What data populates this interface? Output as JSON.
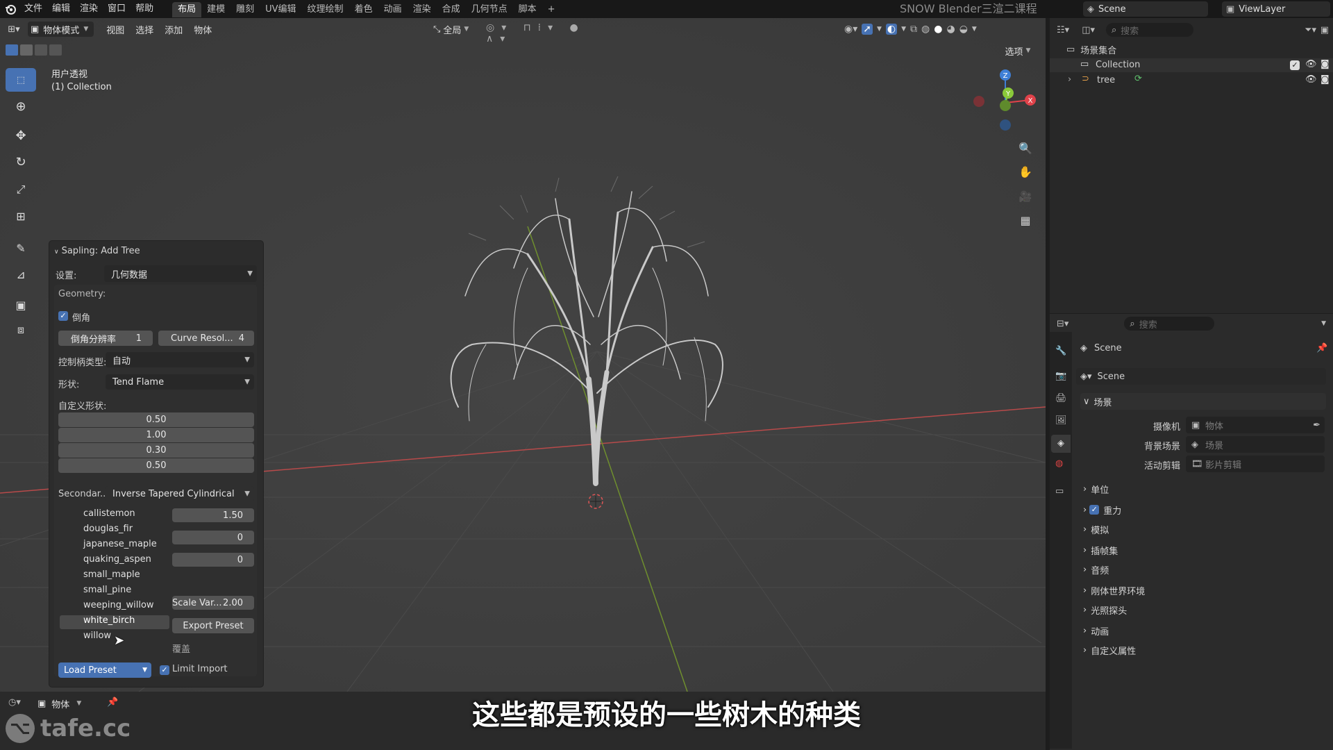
{
  "topbar": {
    "menus": [
      "文件",
      "编辑",
      "渲染",
      "窗口",
      "帮助"
    ],
    "workspaces": [
      "布局",
      "建模",
      "雕刻",
      "UV编辑",
      "纹理绘制",
      "着色",
      "动画",
      "渲染",
      "合成",
      "几何节点",
      "脚本"
    ],
    "active_workspace": "布局",
    "add_tab": "+",
    "brand": "SNOW Blender三渲二课程",
    "scene": "Scene",
    "viewlayer": "ViewLayer"
  },
  "viewport_header": {
    "mode": "物体模式",
    "menus": [
      "视图",
      "选择",
      "添加",
      "物体"
    ],
    "transform_orientation": "全局",
    "options": "选项"
  },
  "viewport": {
    "view_name": "用户透视",
    "collection_info": "(1) Collection"
  },
  "gizmo": {
    "z": "Z",
    "y": "Y",
    "x": "X"
  },
  "sapling": {
    "title": "Sapling: Add Tree",
    "settings_label": "设置:",
    "settings_value": "几何数据",
    "geometry_label": "Geometry:",
    "bevel_label": "倒角",
    "bevel_res_label": "倒角分辨率",
    "bevel_res_value": "1",
    "curve_res_label": "Curve Resol...",
    "curve_res_value": "4",
    "handle_type_label": "控制柄类型:",
    "handle_type_value": "自动",
    "shape_label": "形状:",
    "shape_value": "Tend Flame",
    "custom_shape_label": "自定义形状:",
    "custom_shape_values": [
      "0.50",
      "1.00",
      "0.30",
      "0.50"
    ],
    "secondary_label": "Secondar...",
    "secondary_value": "Inverse Tapered Cylindrical",
    "presets": [
      "callistemon",
      "douglas_fir",
      "japanese_maple",
      "quaking_aspen",
      "small_maple",
      "small_pine",
      "weeping_willow",
      "white_birch",
      "willow"
    ],
    "highlighted_preset": "white_birch",
    "right_values": [
      "1.50",
      "0",
      "0"
    ],
    "scale_var_label": "Scale Var...",
    "scale_var_value": "2.00",
    "export_preset": "Export Preset",
    "overwrite": "覆盖",
    "load_preset": "Load Preset",
    "limit_import": "Limit Import"
  },
  "outliner": {
    "search_placeholder": "搜索",
    "root": "场景集合",
    "collection": "Collection",
    "object": "tree"
  },
  "properties": {
    "search_placeholder": "搜索",
    "breadcrumb": "Scene",
    "scene_name": "Scene",
    "scene_panel": "场景",
    "camera_label": "摄像机",
    "camera_value": "物体",
    "bg_scene_label": "背景场景",
    "bg_scene_value": "场景",
    "active_clip_label": "活动剪辑",
    "active_clip_value": "影片剪辑",
    "collapsed_panels": [
      "单位",
      "重力",
      "模拟",
      "插帧集",
      "音频",
      "刚体世界环境",
      "光照探头",
      "动画",
      "自定义属性"
    ]
  },
  "bottom": {
    "mode": "物体",
    "watermark": "tafe.cc",
    "subtitle": "这些都是预设的一些树木的种类"
  },
  "colors": {
    "accent": "#4772b3",
    "x_axis": "#e0424a",
    "y_axis": "#8ac93a",
    "z_axis": "#3f7fd6"
  }
}
